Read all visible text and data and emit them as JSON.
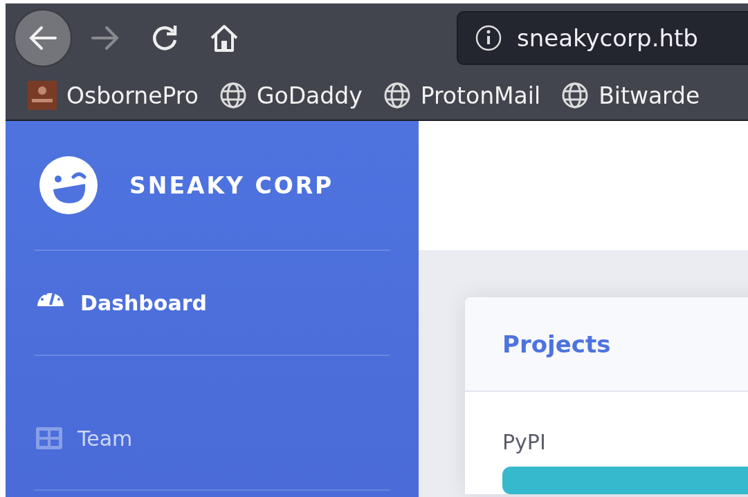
{
  "browser": {
    "url": "sneakycorp.htb",
    "bookmarks": [
      {
        "label": "OsbornePro",
        "kind": "favicon"
      },
      {
        "label": "GoDaddy",
        "kind": "globe"
      },
      {
        "label": "ProtonMail",
        "kind": "globe"
      },
      {
        "label": "Bitwarde",
        "kind": "globe"
      }
    ]
  },
  "sidebar": {
    "brand": "SNEAKY CORP",
    "items": [
      {
        "label": "Dashboard",
        "kind": "gauge",
        "selected": true
      },
      {
        "label": "Team",
        "kind": "table",
        "selected": false
      }
    ]
  },
  "card": {
    "title": "Projects",
    "projects": [
      {
        "name": "PyPI",
        "color": "#36b9cc"
      }
    ]
  }
}
